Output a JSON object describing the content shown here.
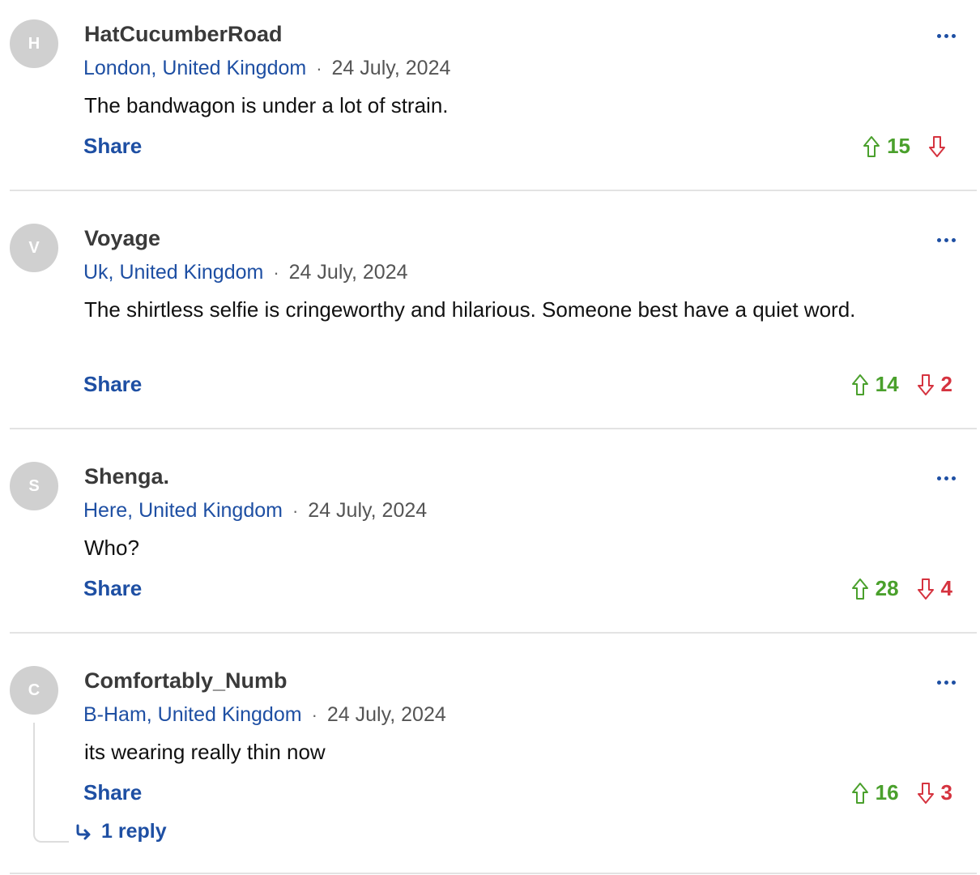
{
  "comments": [
    {
      "initial": "H",
      "username": "HatCucumberRoad",
      "location": "London, United Kingdom",
      "separator": "·",
      "date": "24 July, 2024",
      "text": "The bandwagon is under a lot of strain.",
      "share_label": "Share",
      "upvotes": "15",
      "downvotes": ""
    },
    {
      "initial": "V",
      "username": "Voyage",
      "location": "Uk, United Kingdom",
      "separator": "·",
      "date": "24 July, 2024",
      "text": "The shirtless selfie is cringeworthy and hilarious. Someone best have a quiet word.",
      "share_label": "Share",
      "upvotes": "14",
      "downvotes": "2"
    },
    {
      "initial": "S",
      "username": "Shenga.",
      "location": "Here, United Kingdom",
      "separator": "·",
      "date": "24 July, 2024",
      "text": "Who?",
      "share_label": "Share",
      "upvotes": "28",
      "downvotes": "4"
    },
    {
      "initial": "C",
      "username": "Comfortably_Numb",
      "location": "B-Ham, United Kingdom",
      "separator": "·",
      "date": "24 July, 2024",
      "text": "its wearing really thin now",
      "share_label": "Share",
      "upvotes": "16",
      "downvotes": "3",
      "reply_label": "1 reply"
    }
  ],
  "icons": {
    "more": "more-options-icon",
    "upvote": "arrow-up-icon",
    "downvote": "arrow-down-icon",
    "reply": "reply-arrow-icon"
  },
  "colors": {
    "link_blue": "#1e4fa3",
    "upvote_green": "#4aa02c",
    "downvote_red": "#d5333f",
    "avatar_gray": "#d0d0d0"
  }
}
